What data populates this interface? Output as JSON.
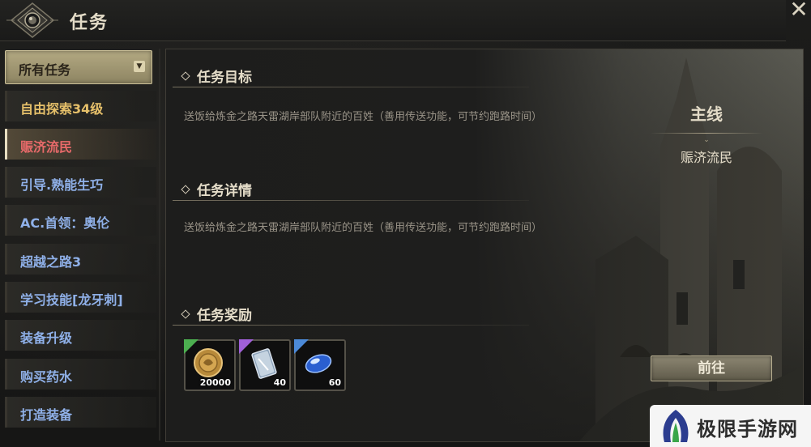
{
  "window": {
    "title": "任务"
  },
  "sidebar": {
    "filter": {
      "selected": "所有任务"
    },
    "items": [
      {
        "label": "自由探索34级",
        "style": "gold"
      },
      {
        "label": "赈济流民",
        "style": "active"
      },
      {
        "label": "引导.熟能生巧",
        "style": "blue"
      },
      {
        "label": "AC.首领：奥伦",
        "style": "blue"
      },
      {
        "label": "超越之路3",
        "style": "blue"
      },
      {
        "label": "学习技能[龙牙刺]",
        "style": "blue"
      },
      {
        "label": "装备升级",
        "style": "blue"
      },
      {
        "label": "购买药水",
        "style": "blue"
      },
      {
        "label": "打造装备",
        "style": "blue"
      }
    ]
  },
  "detail": {
    "objective_title": "任务目标",
    "objective_text": "送饭给炼金之路天雷湖岸部队附近的百姓（善用传送功能，可节约跑路时间）",
    "detail_title": "任务详情",
    "detail_text": "送饭给炼金之路天雷湖岸部队附近的百姓（善用传送功能，可节约跑路时间）",
    "reward_title": "任务奖励",
    "quest_type": "主线",
    "quest_name": "赈济流民",
    "goto_label": "前往"
  },
  "rewards": [
    {
      "icon": "gold-coin-icon",
      "qty": "20000",
      "corner_color": "#4caf50"
    },
    {
      "icon": "scroll-card-icon",
      "qty": "40",
      "corner_color": "#a060d8"
    },
    {
      "icon": "blue-gem-icon",
      "qty": "60",
      "corner_color": "#4c8ad8"
    }
  ],
  "watermark": {
    "text": "极限手游网"
  },
  "colors": {
    "accent_gold": "#e6c06a",
    "quest_blue": "#8fb0e8",
    "active_red": "#e86a6a"
  }
}
